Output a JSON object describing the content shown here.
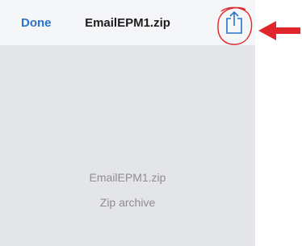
{
  "navbar": {
    "done_label": "Done",
    "title": "EmailEPM1.zip",
    "share_icon": "share-icon"
  },
  "preview": {
    "file_name": "EmailEPM1.zip",
    "file_type": "Zip archive"
  },
  "colors": {
    "accent": "#2a73c8",
    "annotation": "#e0262a",
    "background": "#e3e5e8"
  }
}
